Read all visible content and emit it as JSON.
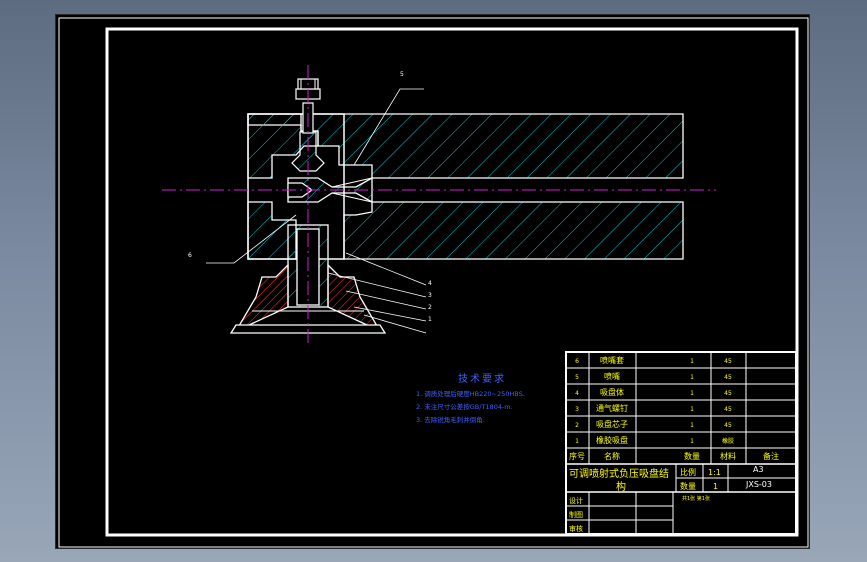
{
  "drawing": {
    "colors": {
      "background": "#000000",
      "frame": "#ffffff",
      "hatch": "#00c8d2",
      "part_outline": "#ffffff",
      "centerline": "#d020d0",
      "table_text": "#ffff00",
      "notes_text": "#4060ff",
      "leader": "#ffffff"
    },
    "leader_numbers": [
      "5",
      "6",
      "4",
      "3",
      "2",
      "1"
    ],
    "tech_requirements": {
      "title": "技术要求",
      "items": [
        "1. 调质处理后硬度HB220~250HBS.",
        "2. 未注尺寸公差按GB/T1804-m.",
        "3. 去除锐角毛刺并倒角."
      ]
    },
    "parts_list": {
      "rows": [
        {
          "no": "6",
          "name": "喷嘴套",
          "qty": "1",
          "material": "45",
          "note": ""
        },
        {
          "no": "5",
          "name": "喷嘴",
          "qty": "1",
          "material": "45",
          "note": ""
        },
        {
          "no": "4",
          "name": "吸盘体",
          "qty": "1",
          "material": "45",
          "note": ""
        },
        {
          "no": "3",
          "name": "通气螺钉",
          "qty": "1",
          "material": "45",
          "note": ""
        },
        {
          "no": "2",
          "name": "吸盘芯子",
          "qty": "1",
          "material": "45",
          "note": ""
        },
        {
          "no": "1",
          "name": "橡胶吸盘",
          "qty": "1",
          "material": "橡胶",
          "note": ""
        }
      ],
      "header": {
        "no": "序号",
        "name": "名称",
        "qty": "数量",
        "material": "材料",
        "note": "备注"
      }
    },
    "title_block": {
      "title_line1": "可调喷射式负压吸盘结",
      "title_line2": "构",
      "scale_label": "比例",
      "scale_value": "1:1",
      "qty_label": "数量",
      "qty_value": "1",
      "sheet_size": "A3",
      "drawing_no": "JXS-03",
      "designer_label": "设计",
      "checker_label": "制图",
      "reviewer_label": "审核",
      "small_note": "共1张 第1张"
    }
  }
}
